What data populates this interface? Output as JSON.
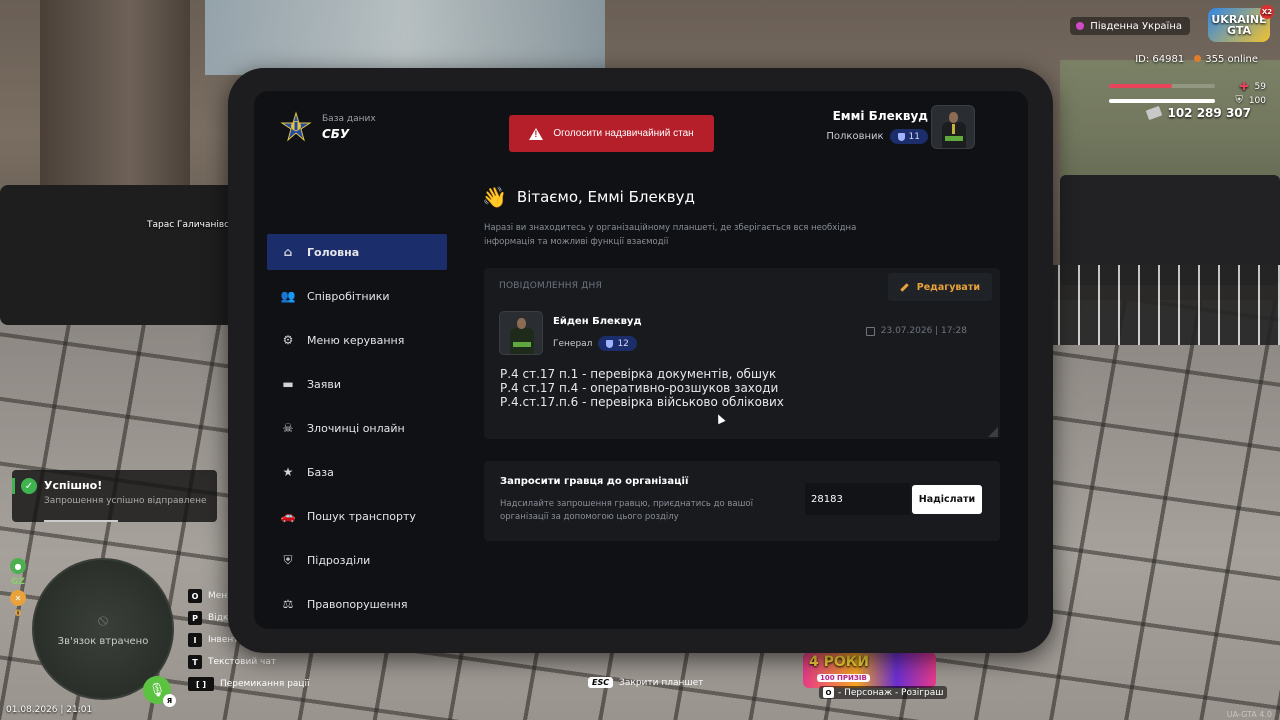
{
  "hud": {
    "region": "Південна Україна",
    "logo_line1": "UKRAINE",
    "logo_line2": "GTA",
    "logo_badge": "X2",
    "player_id": "ID: 64981",
    "online": "355 online",
    "health": "59",
    "armor": "100",
    "health_level": 0.59,
    "armor_level": 1.0,
    "money": "102 289 307",
    "colors": {
      "health": "#e8435a",
      "armor": "#ffffff",
      "online_dot": "#e07b2a"
    }
  },
  "world": {
    "npc_name": "Тарас Галичанівсь"
  },
  "toast": {
    "title": "Успішно!",
    "message": "Запрошення успішно відправлене"
  },
  "side_icons": [
    "GZ",
    "0"
  ],
  "minimap": {
    "status": "Зв'язок втрачено"
  },
  "keys": [
    {
      "key": "O",
      "label": "Мені"
    },
    {
      "key": "P",
      "label": "Відк"
    },
    {
      "key": "I",
      "label": "Інвент"
    },
    {
      "key": "T",
      "label": "Текстовий чат"
    },
    {
      "key": "[ ]",
      "label": "Перемикання рації"
    }
  ],
  "mic_badge": "Я",
  "datetime": "01.08.2026 | 21:01",
  "esc_hint": {
    "key": "ESC",
    "label": "Закрити планшет"
  },
  "promo": {
    "headline": "4 РОКИ",
    "tag": "100 ПРИЗІВ",
    "key": "O",
    "caption": "- Персонаж - Розіграш"
  },
  "version": "UA-GTA 4.0",
  "tablet": {
    "brand_small": "База даних",
    "brand_big": "СБУ",
    "emergency_button": "Оголосити надзвичайний стан",
    "user_name": "Еммі Блеквуд",
    "user_rank": "Полковник",
    "user_level": "11",
    "nav": [
      {
        "label": "Головна",
        "icon": "home-icon",
        "glyph": "⌂",
        "active": true
      },
      {
        "label": "Співробітники",
        "icon": "users-icon",
        "glyph": "👥"
      },
      {
        "label": "Меню керування",
        "icon": "gear-icon",
        "glyph": "⚙"
      },
      {
        "label": "Заяви",
        "icon": "folder-icon",
        "glyph": "▬"
      },
      {
        "label": "Злочинці онлайн",
        "icon": "skull-icon",
        "glyph": "☠"
      },
      {
        "label": "База",
        "icon": "star-icon",
        "glyph": "★"
      },
      {
        "label": "Пошук транспорту",
        "icon": "car-icon",
        "glyph": "🚗"
      },
      {
        "label": "Підрозділи",
        "icon": "shield-icon",
        "glyph": "⛨"
      },
      {
        "label": "Правопорушення",
        "icon": "gavel-icon",
        "glyph": "⚖"
      }
    ],
    "welcome": "Вітаємо, Еммі Блеквуд",
    "intro": "Наразі ви знаходитесь у організаційному планшеті, де зберігається вся необхідна інформація та можливі функції взаємодії",
    "motd": {
      "label": "ПОВІДОМЛЕННЯ ДНЯ",
      "edit": "Редагувати",
      "author": "Ейден Блеквуд",
      "author_rank": "Генерал",
      "author_level": "12",
      "date": "23.07.2026 | 17:28",
      "lines": [
        "Р.4 ст.17 п.1 - перевірка документів, обшук",
        "Р.4 ст.17 п.4 - оперативно-розшуков заходи",
        "Р.4.ст.17.п.6 - перевірка військово облікових"
      ]
    },
    "invite": {
      "title": "Запросити гравця до організації",
      "desc": "Надсилайте запрошення гравцю, приєднатись до вашої організації за допомогою цього розділу",
      "player_id": "28183",
      "send": "Надіслати"
    }
  }
}
